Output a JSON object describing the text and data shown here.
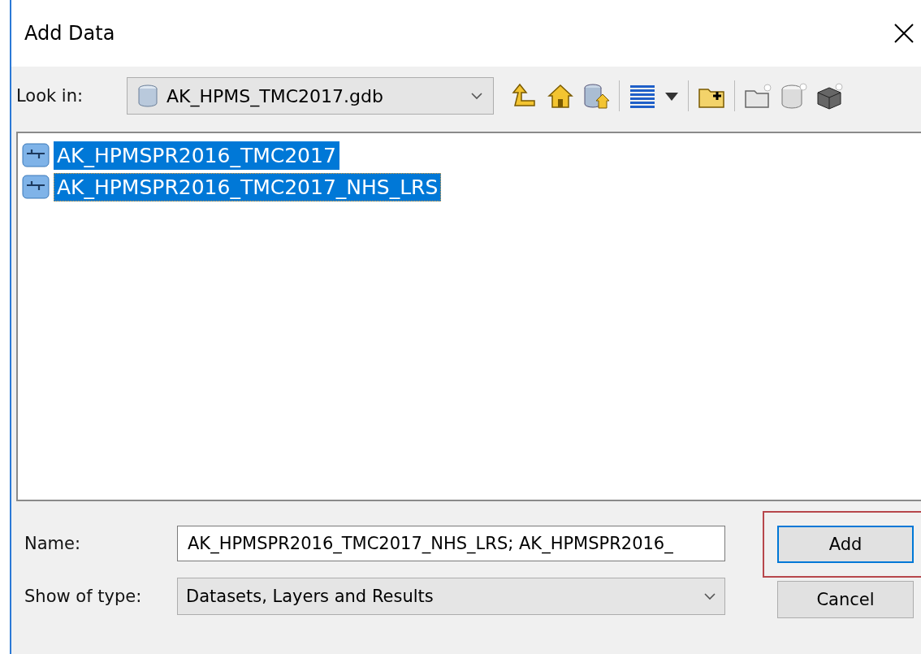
{
  "window": {
    "title": "Add Data"
  },
  "look_in": {
    "label": "Look in:",
    "value": "AK_HPMS_TMC2017.gdb"
  },
  "items": [
    {
      "name": "AK_HPMSPR2016_TMC2017",
      "selected": true,
      "focused": false
    },
    {
      "name": "AK_HPMSPR2016_TMC2017_NHS_LRS",
      "selected": true,
      "focused": true
    }
  ],
  "name_field": {
    "label": "Name:",
    "value": "AK_HPMSPR2016_TMC2017_NHS_LRS; AK_HPMSPR2016_"
  },
  "type_field": {
    "label": "Show of type:",
    "value": "Datasets, Layers and Results"
  },
  "buttons": [
    {
      "label": "Add",
      "kind": "default",
      "highlighted": true
    },
    {
      "label": "Cancel",
      "kind": "normal",
      "highlighted": false
    }
  ]
}
